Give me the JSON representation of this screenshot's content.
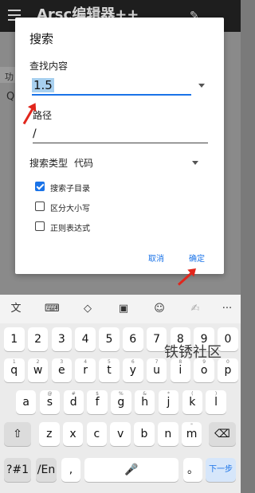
{
  "app": {
    "title": "Arsc编辑器++",
    "strip_label": "功",
    "strip_icon": "Q"
  },
  "dialog": {
    "title": "搜索",
    "find_label": "查找内容",
    "find_value": "1.5",
    "path_label": "路径",
    "path_value": "/",
    "search_type_label": "搜索类型",
    "search_type_value": "代码",
    "checkboxes": [
      {
        "label": "搜索子目录",
        "checked": true
      },
      {
        "label": "区分大小写",
        "checked": false
      },
      {
        "label": "正则表达式",
        "checked": false
      }
    ],
    "cancel": "取消",
    "ok": "确定"
  },
  "watermark": "铁锈社区",
  "keyboard": {
    "toolbar_icons": [
      "translate-icon",
      "keyboard-icon",
      "move-cursor-icon",
      "clipboard-icon",
      "emoji-icon",
      "handwriting-icon",
      "more-icon"
    ],
    "num_row": [
      "1",
      "2",
      "3",
      "4",
      "5",
      "6",
      "7",
      "8",
      "9",
      "0"
    ],
    "row1": [
      "q",
      "w",
      "e",
      "r",
      "t",
      "y",
      "u",
      "i",
      "o",
      "p"
    ],
    "row1_sub": [
      "1",
      "2",
      "3",
      "4",
      "5",
      "6",
      "7",
      "8",
      "9",
      "0"
    ],
    "row2": [
      "a",
      "s",
      "d",
      "f",
      "g",
      "h",
      "j",
      "k",
      "l"
    ],
    "row2_sub": [
      "",
      "@",
      "#",
      "$",
      "%",
      "&",
      "*",
      "(",
      ")"
    ],
    "row3": [
      "z",
      "x",
      "c",
      "v",
      "b",
      "n",
      "m"
    ],
    "row3_sub": [
      "",
      "",
      "",
      "",
      "",
      "",
      "\""
    ],
    "sym_key": "?#1",
    "lang_key": "/En",
    "comma": ",",
    "period": "。",
    "next": "下一步",
    "shift_glyph": "⇧",
    "delete_glyph": "⌫",
    "more_glyph": "···",
    "mic_glyph": "🎤"
  }
}
